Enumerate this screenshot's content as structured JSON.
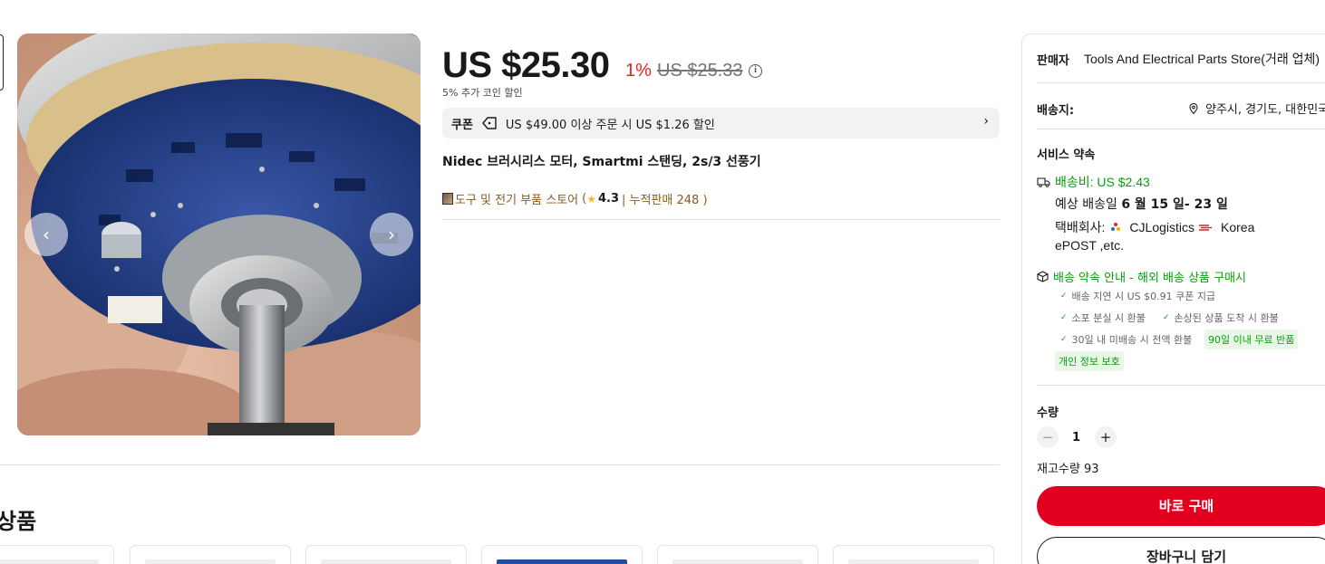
{
  "product": {
    "price": "US $25.30",
    "discount": "1%",
    "original_price": "US $25.33",
    "coin_discount": "5% 추가 코인 할인",
    "coupon": {
      "label": "쿠폰",
      "text": "US $49.00 이상 주문 시 US $1.26 할인"
    },
    "title": "Nidec 브러시리스 모터, Smartmi 스탠딩, 2s/3 선풍기",
    "store": {
      "name": "도구 및 전기 부품 스토어",
      "open_paren": "(",
      "rating": "4.3",
      "sales": "| 누적판매 248 )"
    }
  },
  "related": {
    "title": "상품"
  },
  "panel": {
    "seller_label": "판매자",
    "seller_name": "Tools And Electrical Parts Store(거래 업체)",
    "ship_to_label": "배송지:",
    "ship_to_location": "양주시, 경기도, 대한민국",
    "service_label": "서비스 약속",
    "shipping_fee": "배송비: US $2.43",
    "eta_prefix": "예상 배송일",
    "eta_dates": "6 월 15 일- 23 일",
    "carrier_label": "택배회사:",
    "carrier_1": "CJLogistics",
    "carrier_2": "Korea",
    "carrier_3": "ePOST ,etc.",
    "promise_title": "배송 약속 안내 - 해외 배송 상품 구매시",
    "promise_items": [
      "배송 지연 시 US $0.91 쿠폰 지급",
      "소포 분실 시 환불",
      "손상된 상품 도착 시 환불",
      "30일 내 미배송 시 전액 환불"
    ],
    "badges": [
      "90일 이내 무료 반품",
      "개인 정보 보호"
    ],
    "quantity_label": "수량",
    "quantity_value": "1",
    "qty_minus": "−",
    "qty_plus": "+",
    "stock": "재고수량 93",
    "buy_now": "바로 구매",
    "add_to_cart": "장바구니 담기"
  },
  "colors": {
    "accent_red": "#e1001e",
    "discount_red": "#e1251b",
    "green": "#08a00d",
    "store_brown": "#8a5a1f"
  },
  "icons": [
    "info-icon",
    "coupon-tag-icon",
    "chevron-right-icon",
    "store-icon",
    "star-icon",
    "location-pin-icon",
    "truck-icon",
    "box-icon",
    "check-icon",
    "cj-logo-icon",
    "korea-post-logo-icon",
    "chevron-left-icon"
  ]
}
